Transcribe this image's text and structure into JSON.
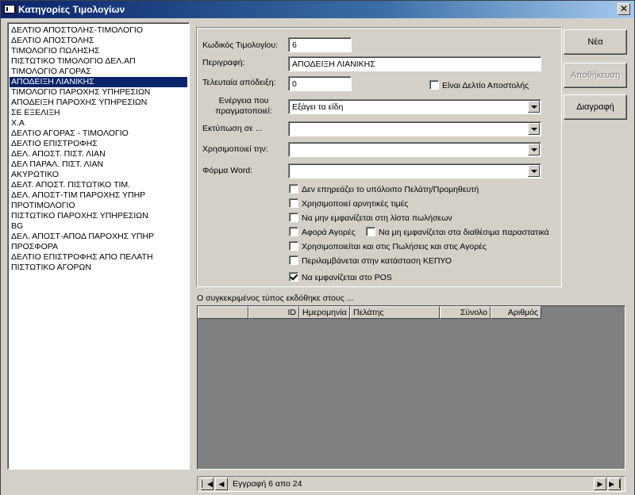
{
  "window": {
    "title": "Κατηγορίες Τιμολογίων",
    "close_glyph": "✕"
  },
  "list": {
    "selected_index": 5,
    "items": [
      "ΔΕΛΤΙΟ ΑΠΟΣΤΟΛΗΣ-ΤΙΜΟΛΟΓΙΟ",
      "ΔΕΛΤΙΟ ΑΠΟΣΤΟΛΗΣ",
      "ΤΙΜΟΛΟΓΙΟ ΠΩΛΗΣΗΣ",
      "ΠΙΣΤΩΤΙΚΟ ΤΙΜΟΛΟΓΙΟ ΔΕΛ.ΑΠ",
      "ΤΙΜΟΛΟΓΙΟ ΑΓΟΡΑΣ",
      "ΑΠΟΔΕΙΞΗ ΛΙΑΝΙΚΗΣ",
      "ΤΙΜΟΛΟΓΙΟ ΠΑΡΟΧΗΣ ΥΠΗΡΕΣΙΩΝ",
      "ΑΠΟΔΕΙΞΗ ΠΑΡΟΧΗΣ ΥΠΗΡΕΣΙΩΝ",
      "ΣΕ ΕΞΕΛΙΞΗ",
      "Χ.Α",
      "ΔΕΛΤΙΟ ΑΓΟΡΑΣ - ΤΙΜΟΛΟΓΙΟ",
      "ΔΕΛΤΙΟ ΕΠΙΣΤΡΟΦΗΣ",
      "ΔΕΛ. ΑΠΟΣΤ. ΠΙΣΤ. ΛΙΑΝ",
      "ΔΕΛ ΠΑΡΑΛ. ΠΙΣΤ. ΛΙΑΝ",
      "ΑΚΥΡΩΤΙΚΟ",
      "ΔΕΛΤ. ΑΠΟΣΤ. ΠΙΣΤΩΤΙΚΟ ΤΙΜ.",
      "ΔΕΛ. ΑΠΟΣΤ-ΤΙΜ ΠΑΡΟΧΗΣ ΥΠΗΡ",
      "ΠΡΟΤΙΜΟΛΟΓΙΟ",
      "ΠΙΣΤΩΤΙΚΟ ΠΑΡΟΧΗΣ ΥΠΗΡΕΣΙΩΝ",
      "BG",
      "ΔΕΛ. ΑΠΟΣΤ-ΑΠΟΔ ΠΑΡΟΧΗΣ ΥΠΗΡ",
      "ΠΡΟΣΦΟΡΑ",
      "ΔΕΛΤΙΟ ΕΠΙΣΤΡΟΦΗΣ ΑΠΟ ΠΕΛΑΤΗ",
      "ΠΙΣΤΩΤΙΚΟ ΑΓΟΡΩΝ"
    ]
  },
  "form": {
    "code_label": "Κωδικός Τιμολογίου:",
    "code_value": "6",
    "desc_label": "Περιγραφή:",
    "desc_value": "ΑΠΟΔΕΙΞΗ ΛΙΑΝΙΚΗΣ",
    "last_label": "Τελευταία απόδειξη:",
    "last_value": "0",
    "is_delivery_label": "Είναι Δελτίο Αποστολής",
    "action_label": "Ενέργεια που πραγματοποιεί:",
    "action_value": "Εξάγει τα είδη",
    "print_label": "Εκτύπωση σε ...",
    "print_value": "",
    "uses_label": "Χρησιμοποιεί την:",
    "uses_value": "",
    "word_label": "Φόρμα Word:",
    "word_value": ""
  },
  "checkboxes": [
    {
      "label": "Δεν επηρεάζει το υπόλοιπο Πελάτη/Προμηθευτή",
      "checked": false
    },
    {
      "label": "Χρησιμοποιεί αρνητικές τιμές",
      "checked": false
    },
    {
      "label": "Να μην εμφανίζεται στη λίστα πωλήσεων",
      "checked": false
    },
    {
      "label": "Αφορά Αγορές",
      "checked": false
    },
    {
      "label": "Να μη εμφανίζεται στα διαθέσιμα παραστατικά",
      "checked": false
    },
    {
      "label": "Χρησιμοποιείται και στις Πωλήσεις και στις Αγορές",
      "checked": false
    },
    {
      "label": "Περιλαμβάνεται στην κατάσταση ΚΕΠΥΟ",
      "checked": false
    },
    {
      "label": "Να εμφανίζεται στο POS",
      "checked": true
    }
  ],
  "buttons": {
    "new": "Νέα",
    "save": "Αποθήκευση",
    "delete": "Διαγραφή"
  },
  "grid": {
    "caption": "Ο συγκεκριμένος τύπος εκδόθηκε στους ...",
    "columns": [
      "",
      "ID",
      "Ημερομηνία",
      "Πελάτης",
      "Σύνολο",
      "Αριθμός"
    ]
  },
  "navigator": {
    "text": "Εγγραφή 6 απο 24"
  }
}
